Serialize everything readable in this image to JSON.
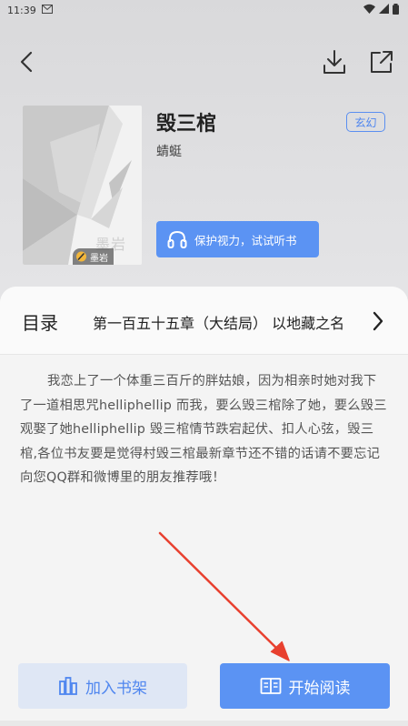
{
  "status_bar": {
    "time": "11:39",
    "icons": [
      "email-icon",
      "wifi-icon",
      "signal-icon",
      "battery-icon"
    ]
  },
  "nav": {
    "back_icon": "chevron-left-icon",
    "download_icon": "download-icon",
    "share_icon": "share-icon"
  },
  "book": {
    "title": "毁三棺",
    "author": "蜻蜓",
    "genre": "玄幻",
    "cover_watermark": "墨岩",
    "cover_badge": "墨岩"
  },
  "listen_button": {
    "label": "保护视力，试试听书"
  },
  "toc": {
    "label": "目录",
    "latest_chapter": "第一百五十五章（大结局） 以地藏之名"
  },
  "synopsis": "我恋上了一个体重三百斤的胖姑娘，因为相亲时她对我下了一道相思咒helliphellip 而我，要么毁三棺除了她，要么毁三观娶了她helliphellip 毁三棺情节跌宕起伏、扣人心弦，毁三棺,各位书友要是觉得村毁三棺最新章节还不错的话请不要忘记向您QQ群和微博里的朋友推荐哦！",
  "bottom_bar": {
    "shelf_label": "加入书架",
    "read_label": "开始阅读"
  },
  "colors": {
    "accent": "#5b93f3",
    "accent_light": "#dfe7f5",
    "annotation_arrow": "#e8402f"
  }
}
